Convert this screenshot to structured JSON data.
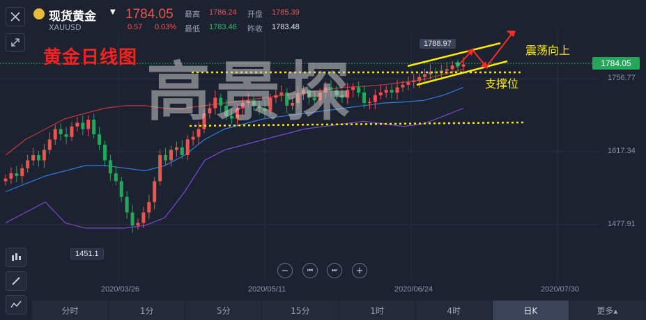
{
  "header": {
    "symbol_name": "现货黄金",
    "symbol_code": "XAUUSD",
    "last_price": "1784.05",
    "change": "0.57",
    "change_pct": "0.03%",
    "high_label": "最高",
    "high_value": "1786.24",
    "open_label": "开盘",
    "open_value": "1785.39",
    "low_label": "最低",
    "low_value": "1783.46",
    "prev_close_label": "昨收",
    "prev_close_value": "1783.48"
  },
  "overlay": {
    "chart_title": "黄金日线图",
    "watermark": "高景探",
    "annotation_up": "震荡向上",
    "annotation_support": "支撑位"
  },
  "price_axis": {
    "current_price": "1784.05",
    "ticks": [
      "1756.77",
      "1617.34",
      "1477.91"
    ]
  },
  "markers": {
    "high_marker": "1788.97",
    "low_marker": "1451.1"
  },
  "date_axis": [
    "2020/03/26",
    "2020/05/11",
    "2020/06/24",
    "2020/07/30"
  ],
  "timeframes": [
    "分时",
    "1分",
    "5分",
    "15分",
    "1时",
    "4时",
    "日K",
    "更多▴"
  ],
  "active_timeframe": "日K",
  "colors": {
    "up": "#ef5350",
    "down": "#26a65b",
    "boll_upper": "#c0393b",
    "boll_mid": "#2f7de1",
    "boll_lower": "#7a4ad8",
    "annotation_yellow": "#ffeb00",
    "title_red": "#ff2020"
  },
  "chart_data": {
    "type": "candlestick",
    "x_start": "2020-02-12",
    "x_end": "2020-08-07",
    "y_axis_ticks": [
      1756.77,
      1617.34,
      1477.91
    ],
    "low_marker": 1451.1,
    "high_marker": 1788.97,
    "current_price": 1784.05,
    "series": [
      {
        "name": "candles",
        "close": [
          1565,
          1575,
          1570,
          1585,
          1600,
          1610,
          1600,
          1620,
          1640,
          1660,
          1650,
          1645,
          1665,
          1672,
          1660,
          1678,
          1650,
          1630,
          1600,
          1575,
          1560,
          1530,
          1500,
          1475,
          1480,
          1500,
          1520,
          1560,
          1610,
          1600,
          1620,
          1625,
          1610,
          1640,
          1645,
          1660,
          1690,
          1700,
          1720,
          1705,
          1685,
          1680,
          1700,
          1710,
          1715,
          1705,
          1700,
          1695,
          1720,
          1725,
          1730,
          1705,
          1710,
          1728,
          1735,
          1720,
          1715,
          1730,
          1740,
          1735,
          1725,
          1720,
          1735,
          1740,
          1730,
          1710,
          1712,
          1725,
          1730,
          1735,
          1730,
          1740,
          1745,
          1750,
          1752,
          1760,
          1765,
          1770,
          1768,
          1772,
          1775,
          1782,
          1780,
          1784
        ]
      },
      {
        "name": "boll_upper",
        "values": [
          1610,
          1640,
          1660,
          1680,
          1690,
          1700,
          1705,
          1705,
          1700,
          1700,
          1705,
          1710,
          1715,
          1720,
          1725,
          1730,
          1735,
          1740,
          1742,
          1745,
          1750,
          1755,
          1765,
          1775
        ]
      },
      {
        "name": "boll_mid",
        "values": [
          1540,
          1555,
          1570,
          1580,
          1590,
          1590,
          1585,
          1580,
          1590,
          1610,
          1640,
          1660,
          1670,
          1680,
          1685,
          1690,
          1695,
          1700,
          1705,
          1710,
          1712,
          1715,
          1725,
          1740
        ]
      },
      {
        "name": "boll_lower",
        "values": [
          1480,
          1500,
          1520,
          1480,
          1470,
          1470,
          1470,
          1475,
          1490,
          1540,
          1600,
          1620,
          1630,
          1640,
          1650,
          1660,
          1665,
          1670,
          1675,
          1670,
          1665,
          1670,
          1685,
          1700
        ]
      }
    ]
  }
}
